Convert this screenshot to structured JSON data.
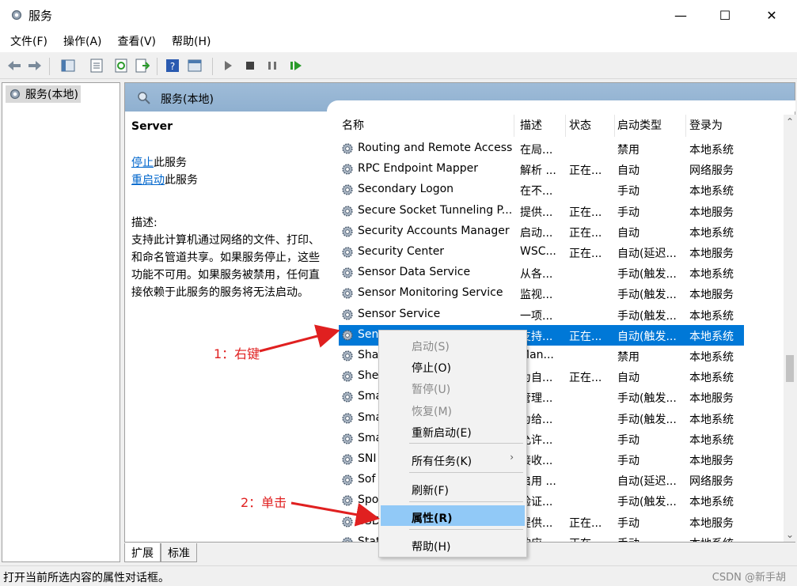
{
  "window": {
    "title": "服务",
    "min": "—",
    "max": "☐",
    "close": "✕"
  },
  "menu": [
    "文件(F)",
    "操作(A)",
    "查看(V)",
    "帮助(H)"
  ],
  "tree": {
    "item": "服务(本地)"
  },
  "panel": {
    "title": "服务(本地)",
    "service_name": "Server",
    "stop_link": "停止",
    "stop_suffix": "此服务",
    "restart_link": "重启动",
    "restart_suffix": "此服务",
    "desc_label": "描述:",
    "desc_text": "支持此计算机通过网络的文件、打印、和命名管道共享。如果服务停止，这些功能不可用。如果服务被禁用，任何直接依赖于此服务的服务将无法启动。"
  },
  "columns": [
    "名称",
    "描述",
    "状态",
    "启动类型",
    "登录为"
  ],
  "rows": [
    {
      "name": "Routing and Remote Access",
      "desc": "在局...",
      "status": "",
      "startup": "禁用",
      "logon": "本地系统"
    },
    {
      "name": "RPC Endpoint Mapper",
      "desc": "解析 ...",
      "status": "正在...",
      "startup": "自动",
      "logon": "网络服务"
    },
    {
      "name": "Secondary Logon",
      "desc": "在不...",
      "status": "",
      "startup": "手动",
      "logon": "本地系统"
    },
    {
      "name": "Secure Socket Tunneling P...",
      "desc": "提供...",
      "status": "正在...",
      "startup": "手动",
      "logon": "本地服务"
    },
    {
      "name": "Security Accounts Manager",
      "desc": "启动...",
      "status": "正在...",
      "startup": "自动",
      "logon": "本地系统"
    },
    {
      "name": "Security Center",
      "desc": "WSC...",
      "status": "正在...",
      "startup": "自动(延迟...",
      "logon": "本地服务"
    },
    {
      "name": "Sensor Data Service",
      "desc": "从各...",
      "status": "",
      "startup": "手动(触发...",
      "logon": "本地系统"
    },
    {
      "name": "Sensor Monitoring Service",
      "desc": "监视...",
      "status": "",
      "startup": "手动(触发...",
      "logon": "本地服务"
    },
    {
      "name": "Sensor Service",
      "desc": "一项...",
      "status": "",
      "startup": "手动(触发...",
      "logon": "本地系统"
    },
    {
      "name": "Sen",
      "desc": "支持...",
      "status": "正在...",
      "startup": "自动(触发...",
      "logon": "本地系统"
    },
    {
      "name": "Sha",
      "desc": "Man...",
      "status": "",
      "startup": "禁用",
      "logon": "本地系统"
    },
    {
      "name": "She",
      "desc": "为自...",
      "status": "正在...",
      "startup": "自动",
      "logon": "本地系统"
    },
    {
      "name": "Sma",
      "desc": "管理...",
      "status": "",
      "startup": "手动(触发...",
      "logon": "本地服务"
    },
    {
      "name": "Sma",
      "desc": "为给...",
      "status": "",
      "startup": "手动(触发...",
      "logon": "本地系统"
    },
    {
      "name": "Sma",
      "desc": "允许...",
      "status": "",
      "startup": "手动",
      "logon": "本地系统"
    },
    {
      "name": "SNI",
      "desc": "接收...",
      "status": "",
      "startup": "手动",
      "logon": "本地服务"
    },
    {
      "name": "Sof",
      "desc": "启用 ...",
      "status": "",
      "startup": "自动(延迟...",
      "logon": "网络服务"
    },
    {
      "name": "Spo",
      "desc": "验证...",
      "status": "",
      "startup": "手动(触发...",
      "logon": "本地系统"
    },
    {
      "name": "SSD",
      "desc": "提供...",
      "status": "正在...",
      "startup": "手动",
      "logon": "本地服务"
    },
    {
      "name": "Stat",
      "desc": "响应...",
      "status": "正在...",
      "startup": "手动",
      "logon": "本地系统"
    }
  ],
  "context_menu": {
    "start": "启动(S)",
    "stop": "停止(O)",
    "pause": "暂停(U)",
    "resume": "恢复(M)",
    "restart": "重新启动(E)",
    "all_tasks": "所有任务(K)",
    "refresh": "刷新(F)",
    "properties": "属性(R)",
    "help": "帮助(H)"
  },
  "tabs": [
    "扩展",
    "标准"
  ],
  "status_text": "打开当前所选内容的属性对话框。",
  "watermark": "CSDN @新手胡",
  "annotations": {
    "step1": "1：右键",
    "step2": "2：单击"
  },
  "colors": {
    "selection": "#0078d7",
    "menu_highlight": "#91c9f7",
    "annotation": "#e02020",
    "link": "#0066cc"
  }
}
